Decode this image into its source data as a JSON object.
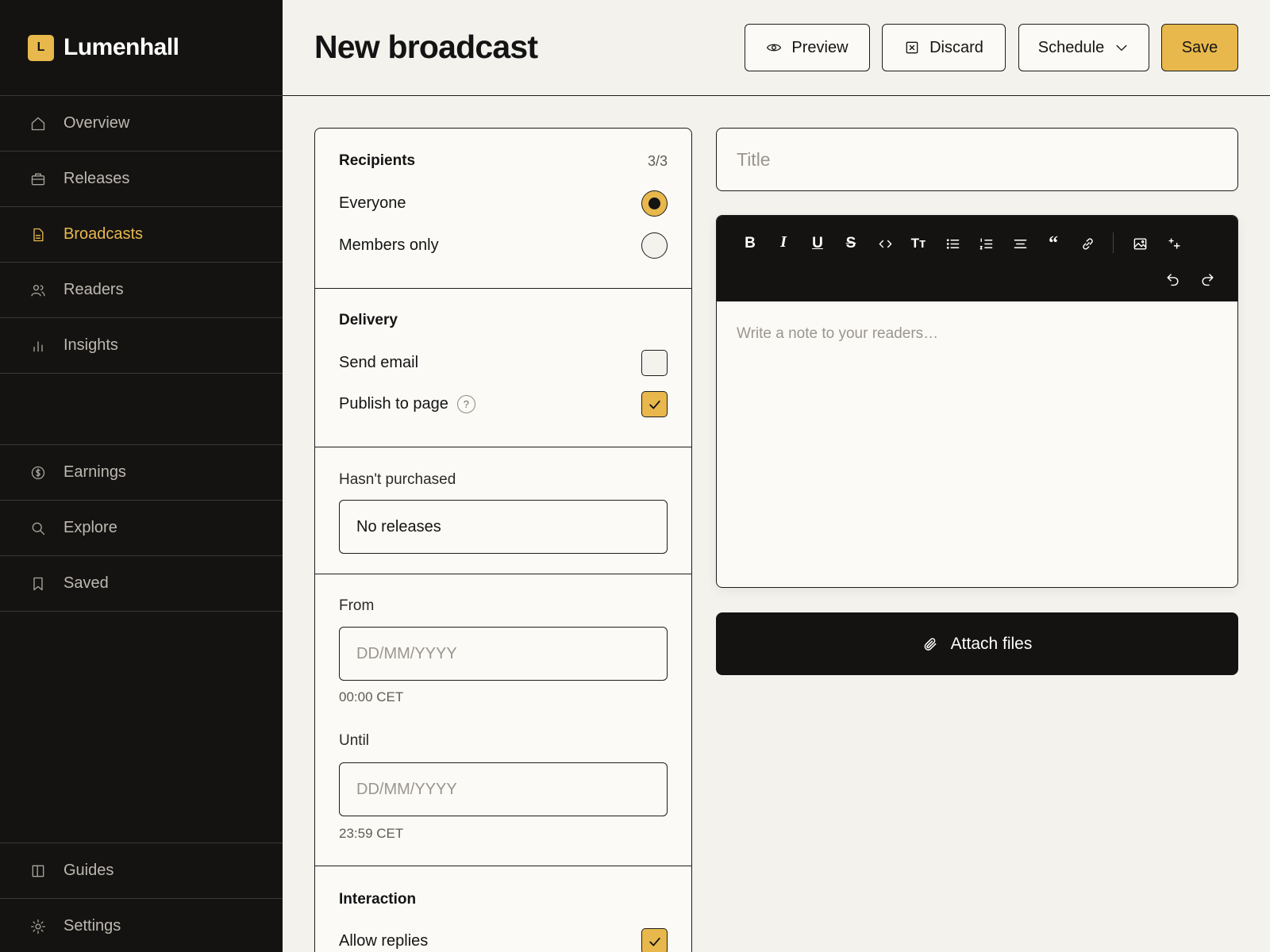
{
  "colors": {
    "accent": "#e8b84c",
    "sidebar_bg": "#141312",
    "page_bg": "#f3f2ed",
    "card_bg": "#fbfaf6"
  },
  "brand": {
    "logo_letter": "L",
    "name": "Lumenhall"
  },
  "sidebar": {
    "items": [
      {
        "label": "Overview",
        "icon": "home-icon",
        "active": false
      },
      {
        "label": "Releases",
        "icon": "briefcase-icon",
        "active": false
      },
      {
        "label": "Broadcasts",
        "icon": "document-icon",
        "active": true
      },
      {
        "label": "Readers",
        "icon": "users-icon",
        "active": false
      },
      {
        "label": "Insights",
        "icon": "bar-chart-icon",
        "active": false
      },
      {
        "label": "Earnings",
        "icon": "dollar-icon",
        "active": false
      },
      {
        "label": "Explore",
        "icon": "search-icon",
        "active": false
      },
      {
        "label": "Saved",
        "icon": "bookmark-icon",
        "active": false
      },
      {
        "label": "Guides",
        "icon": "book-icon",
        "active": false
      },
      {
        "label": "Settings",
        "icon": "gear-icon",
        "active": false
      }
    ]
  },
  "header": {
    "title": "New broadcast",
    "preview_label": "Preview",
    "discard_label": "Discard",
    "schedule_label": "Schedule",
    "save_label": "Save"
  },
  "recipients": {
    "heading": "Recipients",
    "count": "3/3",
    "options": [
      {
        "label": "Everyone",
        "selected": true
      },
      {
        "label": "Members only",
        "selected": false
      }
    ]
  },
  "delivery": {
    "heading": "Delivery",
    "send_email": {
      "label": "Send email",
      "checked": false
    },
    "publish_page": {
      "label": "Publish to page",
      "checked": true,
      "help": "?"
    }
  },
  "purchase_filter": {
    "label": "Hasn't purchased",
    "value": "No releases"
  },
  "date_range": {
    "from_label": "From",
    "from_placeholder": "DD/MM/YYYY",
    "from_time": "00:00 CET",
    "until_label": "Until",
    "until_placeholder": "DD/MM/YYYY",
    "until_time": "23:59 CET"
  },
  "interaction": {
    "heading": "Interaction",
    "allow_replies": {
      "label": "Allow replies",
      "checked": true
    }
  },
  "compose": {
    "title_placeholder": "Title",
    "body_placeholder": "Write a note to your readers…",
    "toolbar": {
      "bold": "B",
      "italic": "I",
      "underline": "U",
      "strike": "S",
      "text_size": "Tт"
    },
    "attach_label": "Attach files"
  }
}
